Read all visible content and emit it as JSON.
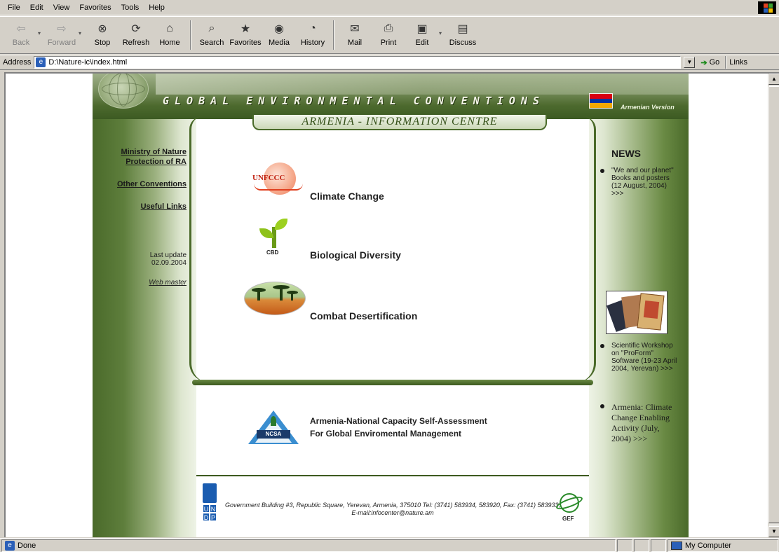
{
  "browser": {
    "menu": [
      "File",
      "Edit",
      "View",
      "Favorites",
      "Tools",
      "Help"
    ],
    "toolbar": {
      "back": "Back",
      "forward": "Forward",
      "stop": "Stop",
      "refresh": "Refresh",
      "home": "Home",
      "search": "Search",
      "favorites": "Favorites",
      "media": "Media",
      "history": "History",
      "mail": "Mail",
      "print": "Print",
      "edit": "Edit",
      "discuss": "Discuss"
    },
    "address": {
      "label": "Address",
      "value": "D:\\Nature-ic\\index.html",
      "go": "Go",
      "links": "Links"
    },
    "status": {
      "text": "Done",
      "zone": "My Computer"
    }
  },
  "site": {
    "banner_title": "GLOBAL ENVIRONMENTAL CONVENTIONS",
    "armenian_version": "Armenian Version",
    "subtitle": "ARMENIA - INFORMATION CENTRE",
    "nav": {
      "ministry_line1": "Ministry of Nature",
      "ministry_line2": "Protection of RA",
      "other": "Other Conventions",
      "links": "Useful Links"
    },
    "update": {
      "label": "Last update",
      "date": "02.09.2004",
      "webmaster": "Web master"
    },
    "topics": {
      "climate": "Climate Change",
      "biodiv": "Biological Diversity",
      "desert": "Combat Desertification",
      "unfccc_logo": "UNFCCC",
      "cbd_logo": "CBD"
    },
    "ncsa": {
      "logo": "NCSA",
      "line1": "Armenia-National Capacity Self-Assessment",
      "line2": "For Global Enviromental Management"
    },
    "footer": {
      "text": "Government Building #3, Republic Square, Yerevan, Armenia, 375010 Tel: (3741) 583934, 583920, Fax: (3741) 583933, E-mail:infocenter@nature.am",
      "gef": "GEF",
      "undp": [
        "U",
        "N",
        "D",
        "P"
      ]
    },
    "news": {
      "title": "NEWS",
      "item1": "\"We and our planet\" Books and posters (12 August, 2004) >>>",
      "item2": "Scientific Workshop on \"ProForm\" Software (19-23 April 2004, Yerevan) >>>",
      "item3": "Armenia: Climate Change Enabling Activity (July, 2004) >>>"
    },
    "colors": {
      "frame_green": "#4a6a2a",
      "flag_red": "#d90012",
      "flag_blue": "#0033a0",
      "flag_orange": "#f2a800"
    }
  }
}
